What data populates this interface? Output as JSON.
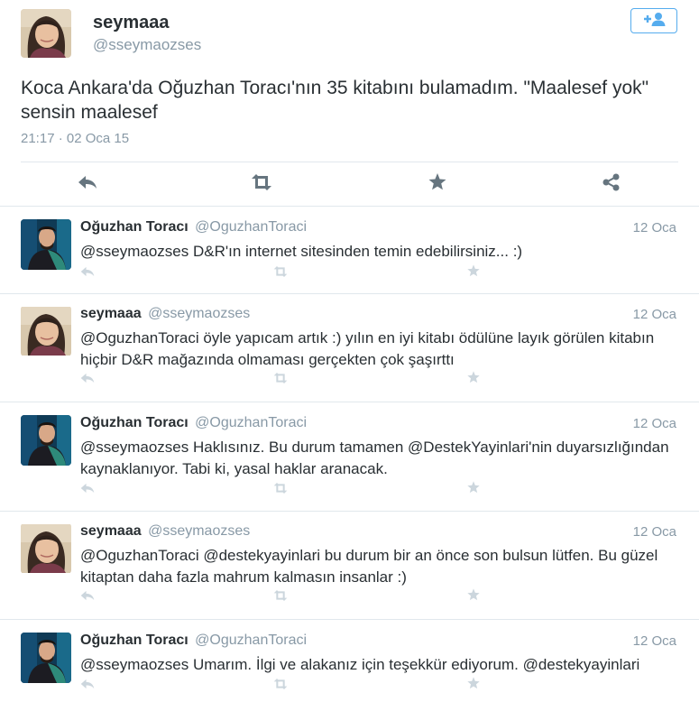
{
  "main_tweet": {
    "name": "seymaaa",
    "handle": "@sseymaozses",
    "text": "Koca Ankara'da Oğuzhan Toracı'nın 35 kitabını bulamadım.  \"Maalesef yok\" sensin maalesef",
    "timestamp": "21:17 · 02 Oca 15",
    "actions": [
      "reply-icon",
      "retweet-icon",
      "favorite-icon",
      "share-icon"
    ],
    "follow_icon": "follow-icon"
  },
  "replies": [
    {
      "name": "Oğuzhan Toracı",
      "handle": "@OguzhanToraci",
      "date": "12 Oca",
      "text": "@sseymaozses D&R'ın internet sitesinden temin edebilirsiniz... :)"
    },
    {
      "name": "seymaaa",
      "handle": "@sseymaozses",
      "date": "12 Oca",
      "text": "@OguzhanToraci öyle yapıcam artık :) yılın en iyi kitabı ödülüne layık görülen kitabın hiçbir D&R mağazında olmaması gerçekten çok şaşırttı"
    },
    {
      "name": "Oğuzhan Toracı",
      "handle": "@OguzhanToraci",
      "date": "12 Oca",
      "text": "@sseymaozses Haklısınız. Bu durum tamamen @DestekYayinlari'nin duyarsızlığından kaynaklanıyor. Tabi ki, yasal haklar aranacak."
    },
    {
      "name": "seymaaa",
      "handle": "@sseymaozses",
      "date": "12 Oca",
      "text": "@OguzhanToraci @destekyayinlari bu durum bir an önce son bulsun lütfen. Bu güzel kitaptan daha fazla mahrum kalmasın insanlar :)"
    },
    {
      "name": "Oğuzhan Toracı",
      "handle": "@OguzhanToraci",
      "date": "12 Oca",
      "text": "@sseymaozses Umarım. İlgi ve alakanız için teşekkür ediyorum. @destekyayinlari"
    }
  ],
  "colors": {
    "accent": "#55acee",
    "text": "#292f33",
    "muted": "#8899a6",
    "icon_light": "#ccd6dd",
    "icon_dark": "#66757f",
    "divider": "#e1e8ed"
  }
}
